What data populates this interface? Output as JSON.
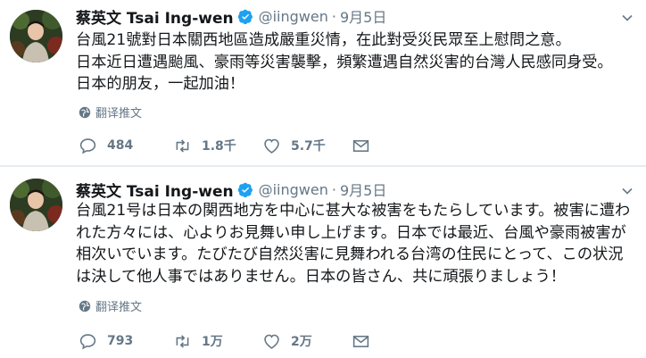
{
  "tweets": [
    {
      "author_name": "蔡英文 Tsai Ing-wen",
      "handle": "@iingwen",
      "separator": "·",
      "date": "9月5日",
      "lines": [
        "台風21號對日本關西地區造成嚴重災情，在此對受災民眾至上慰問之意。",
        "日本近日遭遇颱風、豪雨等災害襲擊，頻繁遭遇自然災害的台灣人民感同身受。",
        "日本的朋友，一起加油！"
      ],
      "translate_label": "翻译推文",
      "replies": "484",
      "retweets": "1.8千",
      "likes": "5.7千"
    },
    {
      "author_name": "蔡英文 Tsai Ing-wen",
      "handle": "@iingwen",
      "separator": "·",
      "date": "9月5日",
      "lines": [
        "台風21号は日本の関西地方を中心に甚大な被害をもたらしています。被害に遭わ",
        "れた方々には、心よりお見舞い申し上げます。日本では最近、台風や豪雨被害が",
        "相次いでいます。たびたび自然災害に見舞われる台湾の住民にとって、この状況",
        "は決して他人事ではありません。日本の皆さん、共に頑張りましょう！"
      ],
      "translate_label": "翻译推文",
      "replies": "793",
      "retweets": "1万",
      "likes": "2万"
    }
  ],
  "icons": {
    "verified": "verified-badge-icon",
    "caret": "chevron-down-icon",
    "translate": "globe-icon",
    "reply": "reply-icon",
    "retweet": "retweet-icon",
    "like": "heart-icon",
    "dm": "envelope-icon"
  },
  "colors": {
    "verified": "#1da1f2",
    "icon_gray": "#657786",
    "text": "#14171a",
    "divider": "#e6ecf0"
  }
}
